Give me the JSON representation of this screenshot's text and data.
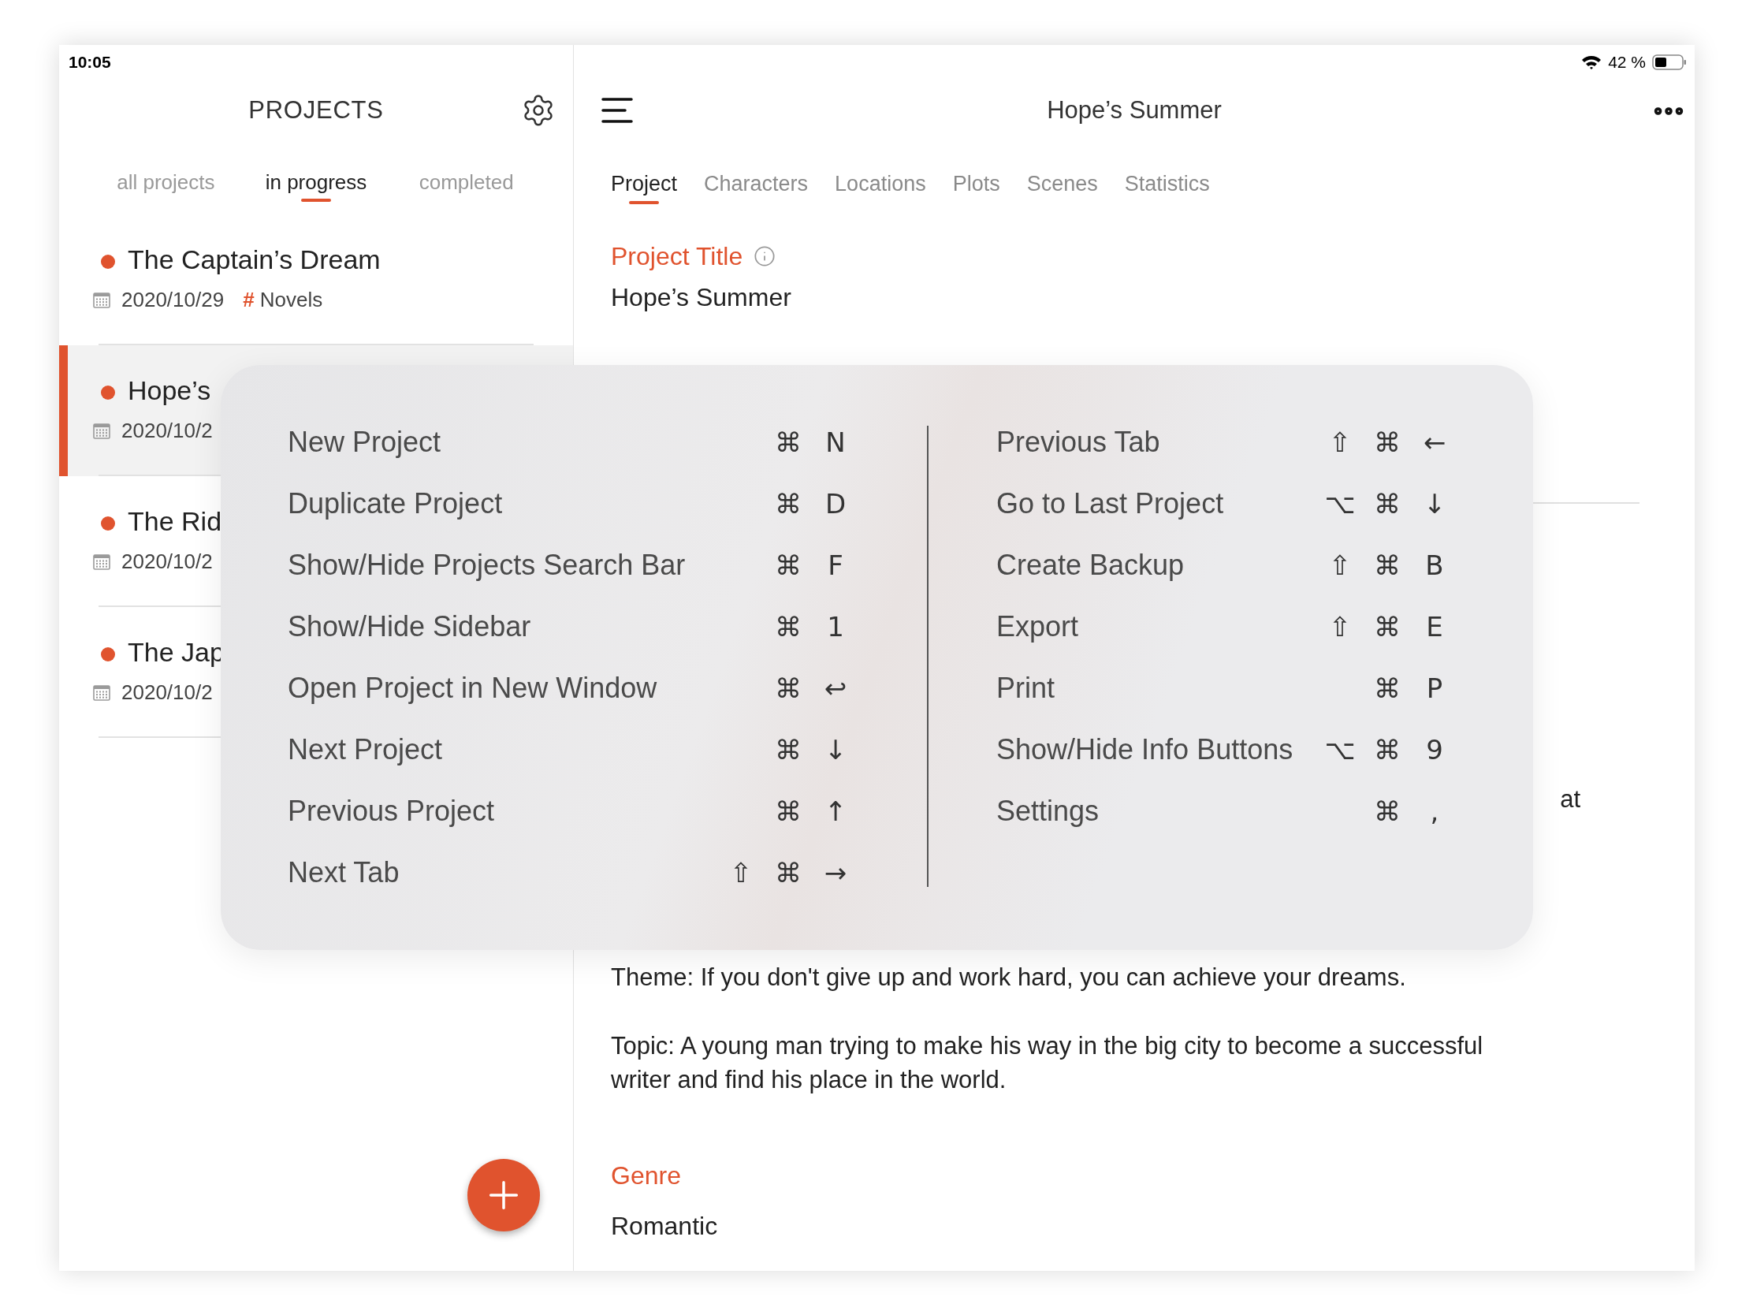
{
  "status_bar": {
    "time": "10:05",
    "battery": "42 %"
  },
  "sidebar": {
    "title": "PROJECTS",
    "filters": [
      {
        "label": "all projects",
        "selected": false
      },
      {
        "label": "in progress",
        "selected": true
      },
      {
        "label": "completed",
        "selected": false
      }
    ],
    "projects": [
      {
        "title": "The Captain’s Dream",
        "date": "2020/10/29",
        "tag": {
          "symbol": "#",
          "label": "Novels"
        },
        "selected": false
      },
      {
        "title": "Hope’s",
        "date": "2020/10/2",
        "selected": true
      },
      {
        "title": "The Rid",
        "date": "2020/10/2",
        "selected": false
      },
      {
        "title": "The Jap",
        "date": "2020/10/2",
        "selected": false
      }
    ]
  },
  "header": {
    "title": "Hope’s Summer"
  },
  "tabs": [
    {
      "label": "Project",
      "selected": true
    },
    {
      "label": "Characters",
      "selected": false
    },
    {
      "label": "Locations",
      "selected": false
    },
    {
      "label": "Plots",
      "selected": false
    },
    {
      "label": "Scenes",
      "selected": false
    },
    {
      "label": "Statistics",
      "selected": false
    }
  ],
  "project_title": {
    "label": "Project Title",
    "value": "Hope’s Summer"
  },
  "hidden_fragment": "at",
  "description": [
    "Theme: If you don't give up and work hard, you can achieve your dreams.",
    "Topic: A young man trying to make his way in the big city to become a successful writer and find his place in the world."
  ],
  "genre": {
    "label": "Genre",
    "value": "Romantic"
  },
  "shortcuts": {
    "columns": [
      [
        {
          "label": "New Project",
          "keys": [
            "⌘",
            "N"
          ]
        },
        {
          "label": "Duplicate Project",
          "keys": [
            "⌘",
            "D"
          ]
        },
        {
          "label": "Show/Hide Projects Search Bar",
          "keys": [
            "⌘",
            "F"
          ]
        },
        {
          "label": "Show/Hide Sidebar",
          "keys": [
            "⌘",
            "1"
          ]
        },
        {
          "label": "Open Project in New Window",
          "keys": [
            "⌘",
            "↩"
          ]
        },
        {
          "label": "Next Project",
          "keys": [
            "⌘",
            "↓"
          ]
        },
        {
          "label": "Previous Project",
          "keys": [
            "⌘",
            "↑"
          ]
        },
        {
          "label": "Next Tab",
          "keys": [
            "⇧",
            "⌘",
            "→"
          ]
        }
      ],
      [
        {
          "label": "Previous Tab",
          "keys": [
            "⇧",
            "⌘",
            "←"
          ]
        },
        {
          "label": "Go to Last Project",
          "keys": [
            "⌥",
            "⌘",
            "↓"
          ]
        },
        {
          "label": "Create Backup",
          "keys": [
            "⇧",
            "⌘",
            "B"
          ]
        },
        {
          "label": "Export",
          "keys": [
            "⇧",
            "⌘",
            "E"
          ]
        },
        {
          "label": "Print",
          "keys": [
            "⌘",
            "P"
          ]
        },
        {
          "label": "Show/Hide Info Buttons",
          "keys": [
            "⌥",
            "⌘",
            "9"
          ]
        },
        {
          "label": "Settings",
          "keys": [
            "⌘",
            ","
          ]
        }
      ]
    ]
  }
}
